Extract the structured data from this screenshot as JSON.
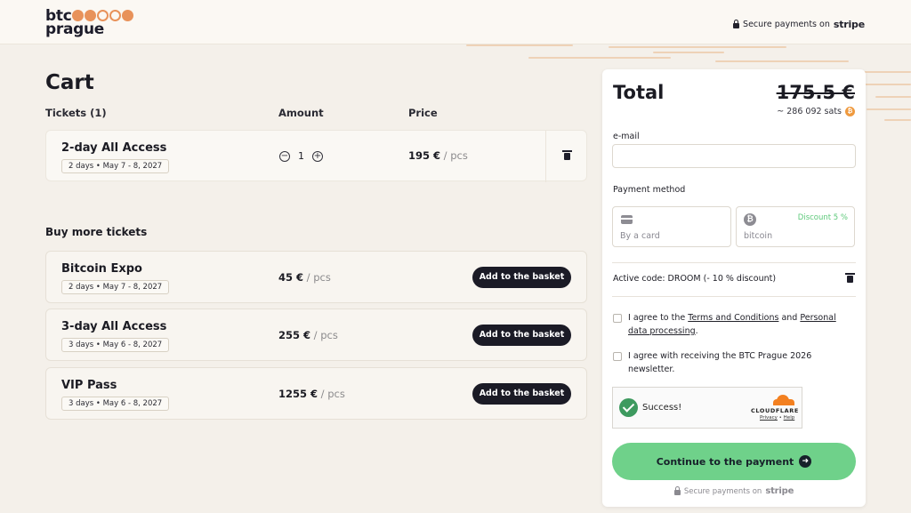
{
  "header": {
    "logo_line1": "btc",
    "logo_line2": "prague",
    "secure_text": "Secure payments on",
    "secure_brand": "stripe"
  },
  "cart": {
    "title": "Cart",
    "col_tickets": "Tickets (1)",
    "col_amount": "Amount",
    "col_price": "Price",
    "items": [
      {
        "name": "2-day All Access",
        "date": "2 days • May 7 - 8, 2027",
        "quantity": "1",
        "price": "195 €",
        "unit": "/ pcs"
      }
    ]
  },
  "buy_more": {
    "title": "Buy more tickets",
    "button_label": "Add to the basket",
    "tickets": [
      {
        "name": "Bitcoin Expo",
        "date": "2 days • May 7 - 8, 2027",
        "price": "45 €",
        "unit": "/ pcs"
      },
      {
        "name": "3-day All Access",
        "date": "3 days • May 6 - 8, 2027",
        "price": "255 €",
        "unit": "/ pcs"
      },
      {
        "name": "VIP Pass",
        "date": "3 days • May 6 - 8, 2027",
        "price": "1255 €",
        "unit": "/ pcs"
      }
    ]
  },
  "checkout": {
    "total_label": "Total",
    "total_price": "175.5 €",
    "sats": "~ 286 092 sats",
    "email_label": "e-mail",
    "email_value": "",
    "payment_method_label": "Payment method",
    "pay_card_label": "By a card",
    "pay_btc_label": "bitcoin",
    "btc_discount": "Discount 5 %",
    "active_code": "Active code: DROOM (- 10 % discount)",
    "agree_terms_prefix": "I agree to the ",
    "agree_terms_link1": "Terms and Conditions",
    "agree_terms_and": " and ",
    "agree_terms_link2": "Personal data processing",
    "agree_terms_suffix": ".",
    "agree_newsletter": "I agree with receiving the BTC Prague 2026 newsletter.",
    "captcha_status": "Success!",
    "captcha_brand": "CLOUDFLARE",
    "captcha_privacy": "Privacy",
    "captcha_sep": " • ",
    "captcha_help": "Help",
    "continue_label": "Continue to the payment",
    "secure_text": "Secure payments on",
    "secure_brand": "stripe"
  },
  "colors": {
    "accent_orange": "#e8925a",
    "continue_green": "#6fd18a",
    "dark_button": "#1b1b26",
    "discount_green": "#5dc97a"
  }
}
